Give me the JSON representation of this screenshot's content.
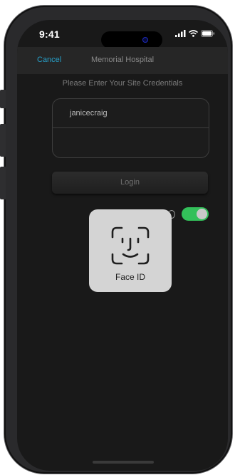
{
  "status_bar": {
    "time": "9:41"
  },
  "nav": {
    "cancel_label": "Cancel",
    "title": "Memorial Hospital"
  },
  "form": {
    "prompt": "Please Enter Your Site Credentials",
    "username_value": "janicecraig",
    "password_value": "",
    "login_label": "Login",
    "toggle_on": true
  },
  "face_id": {
    "label": "Face ID"
  },
  "colors": {
    "accent": "#27a0c9",
    "toggle_on": "#33c05a",
    "screen_bg": "#191919"
  },
  "icons": {
    "face_id": "face-id-icon",
    "signal": "signal-icon",
    "wifi": "wifi-icon",
    "battery": "battery-icon"
  }
}
